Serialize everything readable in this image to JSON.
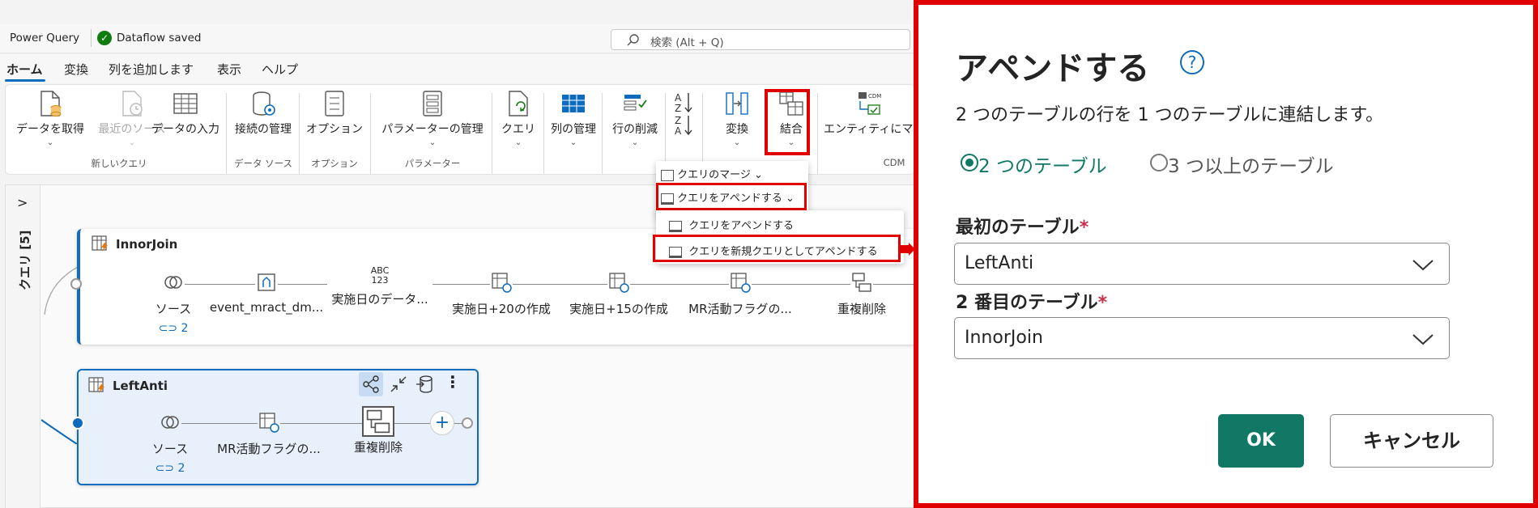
{
  "app": {
    "name": "Power Query",
    "save_status": "Dataflow saved",
    "search_placeholder": "検索 (Alt + Q)"
  },
  "menu": [
    "ホーム",
    "変換",
    "列を追加します",
    "表示",
    "ヘルプ"
  ],
  "ribbon": {
    "get_data": "データを取得",
    "recent_sources": "最近のソース",
    "enter_data": "データの入力",
    "group_new_query": "新しいクエリ",
    "manage_connections": "接続の管理",
    "group_data_source": "データ ソース",
    "options": "オプション",
    "group_options": "オプション",
    "manage_parameters": "パラメーターの管理",
    "group_parameters": "パラメーター",
    "query": "クエリ",
    "manage_columns": "列の管理",
    "reduce_rows": "行の削減",
    "sort_az": "A↓Z",
    "transform": "変換",
    "combine": "結合",
    "entity": "エンティティにマ",
    "group_cdm": "CDM",
    "cdm_badge": "CDM"
  },
  "combine_menu": {
    "merge": "クエリのマージ",
    "append": "クエリをアペンドする",
    "append_sub": "クエリをアペンドする",
    "append_new": "クエリを新規クエリとしてアペンドする"
  },
  "queries_panel": {
    "label": "クエリ [5]",
    "expand": ">"
  },
  "cards": [
    {
      "title": "InnorJoin",
      "steps": [
        "ソース",
        "event_mract_dm...",
        "実施日のデータ...",
        "実施日+20の作成",
        "実施日+15の作成",
        "MR活動フラグの...",
        "重複削除"
      ],
      "abc_label": "ABC\n123",
      "link_count": "2"
    },
    {
      "title": "LeftAnti",
      "steps": [
        "ソース",
        "MR活動フラグの...",
        "重複削除"
      ],
      "link_count": "2",
      "add": "+"
    }
  ],
  "dialog": {
    "title": "アペンドする",
    "help": "?",
    "description": "2 つのテーブルの行を 1 つのテーブルに連結します。",
    "radio_two": "2 つのテーブル",
    "radio_three": "3 つ以上のテーブル",
    "first_label": "最初のテーブル",
    "first_value": "LeftAnti",
    "second_label": "2 番目のテーブル",
    "second_value": "InnorJoin",
    "required": "*",
    "ok": "OK",
    "cancel": "キャンセル"
  },
  "colors": {
    "accent": "#0f6cbd",
    "highlight": "#e00000",
    "ok_button": "#117865",
    "success": "#107c10"
  }
}
